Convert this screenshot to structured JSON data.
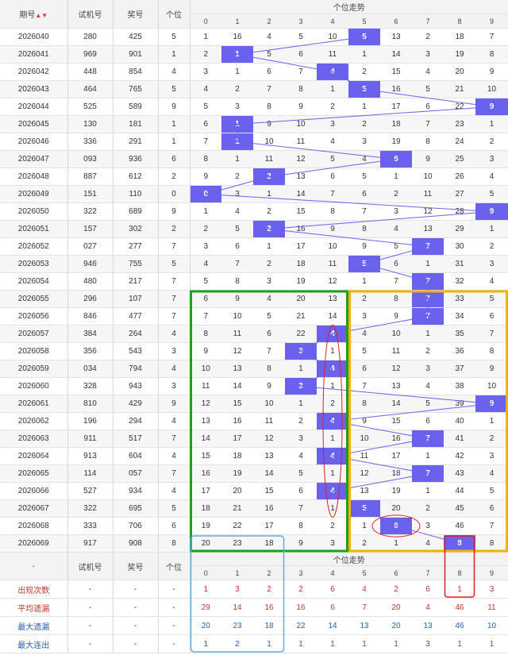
{
  "header": {
    "issue": "期号",
    "sort_arrow": "▲▼",
    "trial": "试机号",
    "prize": "奖号",
    "units": "个位",
    "trend": "个位走势",
    "digits": [
      "0",
      "1",
      "2",
      "3",
      "4",
      "5",
      "6",
      "7",
      "8",
      "9"
    ]
  },
  "rows": [
    {
      "issue": "2026040",
      "trial": "280",
      "prize": "425",
      "unit": "5",
      "cells": [
        "1",
        "16",
        "4",
        "5",
        "10",
        "5",
        "13",
        "2",
        "18",
        "7"
      ]
    },
    {
      "issue": "2026041",
      "trial": "969",
      "prize": "901",
      "unit": "1",
      "cells": [
        "2",
        "1",
        "5",
        "6",
        "11",
        "1",
        "14",
        "3",
        "19",
        "8"
      ]
    },
    {
      "issue": "2026042",
      "trial": "448",
      "prize": "854",
      "unit": "4",
      "cells": [
        "3",
        "1",
        "6",
        "7",
        "4",
        "2",
        "15",
        "4",
        "20",
        "9"
      ]
    },
    {
      "issue": "2026043",
      "trial": "464",
      "prize": "765",
      "unit": "5",
      "cells": [
        "4",
        "2",
        "7",
        "8",
        "1",
        "5",
        "16",
        "5",
        "21",
        "10"
      ]
    },
    {
      "issue": "2026044",
      "trial": "525",
      "prize": "589",
      "unit": "9",
      "cells": [
        "5",
        "3",
        "8",
        "9",
        "2",
        "1",
        "17",
        "6",
        "22",
        "9"
      ]
    },
    {
      "issue": "2026045",
      "trial": "130",
      "prize": "181",
      "unit": "1",
      "cells": [
        "6",
        "1",
        "9",
        "10",
        "3",
        "2",
        "18",
        "7",
        "23",
        "1"
      ]
    },
    {
      "issue": "2026046",
      "trial": "336",
      "prize": "291",
      "unit": "1",
      "cells": [
        "7",
        "1",
        "10",
        "11",
        "4",
        "3",
        "19",
        "8",
        "24",
        "2"
      ]
    },
    {
      "issue": "2026047",
      "trial": "093",
      "prize": "936",
      "unit": "6",
      "cells": [
        "8",
        "1",
        "11",
        "12",
        "5",
        "4",
        "6",
        "9",
        "25",
        "3"
      ]
    },
    {
      "issue": "2026048",
      "trial": "887",
      "prize": "612",
      "unit": "2",
      "cells": [
        "9",
        "2",
        "2",
        "13",
        "6",
        "5",
        "1",
        "10",
        "26",
        "4"
      ]
    },
    {
      "issue": "2026049",
      "trial": "151",
      "prize": "110",
      "unit": "0",
      "cells": [
        "0",
        "3",
        "1",
        "14",
        "7",
        "6",
        "2",
        "11",
        "27",
        "5"
      ]
    },
    {
      "issue": "2026050",
      "trial": "322",
      "prize": "689",
      "unit": "9",
      "cells": [
        "1",
        "4",
        "2",
        "15",
        "8",
        "7",
        "3",
        "12",
        "28",
        "9"
      ]
    },
    {
      "issue": "2026051",
      "trial": "157",
      "prize": "302",
      "unit": "2",
      "cells": [
        "2",
        "5",
        "2",
        "16",
        "9",
        "8",
        "4",
        "13",
        "29",
        "1"
      ]
    },
    {
      "issue": "2026052",
      "trial": "027",
      "prize": "277",
      "unit": "7",
      "cells": [
        "3",
        "6",
        "1",
        "17",
        "10",
        "9",
        "5",
        "7",
        "30",
        "2"
      ]
    },
    {
      "issue": "2026053",
      "trial": "946",
      "prize": "755",
      "unit": "5",
      "cells": [
        "4",
        "7",
        "2",
        "18",
        "11",
        "5",
        "6",
        "1",
        "31",
        "3"
      ]
    },
    {
      "issue": "2026054",
      "trial": "480",
      "prize": "217",
      "unit": "7",
      "cells": [
        "5",
        "8",
        "3",
        "19",
        "12",
        "1",
        "7",
        "7",
        "32",
        "4"
      ]
    },
    {
      "issue": "2026055",
      "trial": "296",
      "prize": "107",
      "unit": "7",
      "cells": [
        "6",
        "9",
        "4",
        "20",
        "13",
        "2",
        "8",
        "7",
        "33",
        "5"
      ]
    },
    {
      "issue": "2026056",
      "trial": "846",
      "prize": "477",
      "unit": "7",
      "cells": [
        "7",
        "10",
        "5",
        "21",
        "14",
        "3",
        "9",
        "7",
        "34",
        "6"
      ]
    },
    {
      "issue": "2026057",
      "trial": "384",
      "prize": "264",
      "unit": "4",
      "cells": [
        "8",
        "11",
        "6",
        "22",
        "4",
        "4",
        "10",
        "1",
        "35",
        "7"
      ]
    },
    {
      "issue": "2026058",
      "trial": "356",
      "prize": "543",
      "unit": "3",
      "cells": [
        "9",
        "12",
        "7",
        "3",
        "1",
        "5",
        "11",
        "2",
        "36",
        "8"
      ]
    },
    {
      "issue": "2026059",
      "trial": "034",
      "prize": "794",
      "unit": "4",
      "cells": [
        "10",
        "13",
        "8",
        "1",
        "4",
        "6",
        "12",
        "3",
        "37",
        "9"
      ]
    },
    {
      "issue": "2026060",
      "trial": "328",
      "prize": "943",
      "unit": "3",
      "cells": [
        "11",
        "14",
        "9",
        "3",
        "1",
        "7",
        "13",
        "4",
        "38",
        "10"
      ]
    },
    {
      "issue": "2026061",
      "trial": "810",
      "prize": "429",
      "unit": "9",
      "cells": [
        "12",
        "15",
        "10",
        "1",
        "2",
        "8",
        "14",
        "5",
        "39",
        "9"
      ]
    },
    {
      "issue": "2026062",
      "trial": "196",
      "prize": "294",
      "unit": "4",
      "cells": [
        "13",
        "16",
        "11",
        "2",
        "4",
        "9",
        "15",
        "6",
        "40",
        "1"
      ]
    },
    {
      "issue": "2026063",
      "trial": "911",
      "prize": "517",
      "unit": "7",
      "cells": [
        "14",
        "17",
        "12",
        "3",
        "1",
        "10",
        "16",
        "7",
        "41",
        "2"
      ]
    },
    {
      "issue": "2026064",
      "trial": "913",
      "prize": "604",
      "unit": "4",
      "cells": [
        "15",
        "18",
        "13",
        "4",
        "4",
        "11",
        "17",
        "1",
        "42",
        "3"
      ]
    },
    {
      "issue": "2026065",
      "trial": "114",
      "prize": "057",
      "unit": "7",
      "cells": [
        "16",
        "19",
        "14",
        "5",
        "1",
        "12",
        "18",
        "7",
        "43",
        "4"
      ]
    },
    {
      "issue": "2026066",
      "trial": "527",
      "prize": "934",
      "unit": "4",
      "cells": [
        "17",
        "20",
        "15",
        "6",
        "4",
        "13",
        "19",
        "1",
        "44",
        "5"
      ]
    },
    {
      "issue": "2026067",
      "trial": "322",
      "prize": "695",
      "unit": "5",
      "cells": [
        "18",
        "21",
        "16",
        "7",
        "1",
        "5",
        "20",
        "2",
        "45",
        "6"
      ]
    },
    {
      "issue": "2026068",
      "trial": "333",
      "prize": "706",
      "unit": "6",
      "cells": [
        "19",
        "22",
        "17",
        "8",
        "2",
        "1",
        "6",
        "3",
        "46",
        "7"
      ]
    },
    {
      "issue": "2026069",
      "trial": "917",
      "prize": "908",
      "unit": "8",
      "cells": [
        "20",
        "23",
        "18",
        "9",
        "3",
        "2",
        "1",
        "4",
        "8",
        "8"
      ]
    }
  ],
  "footer": {
    "dash": "-",
    "trial": "试机号",
    "prize": "奖号",
    "units": "个位",
    "trend": "个位走势",
    "stats": [
      {
        "label": "出现次数",
        "style": "red",
        "values": [
          "1",
          "3",
          "2",
          "2",
          "6",
          "4",
          "2",
          "6",
          "1",
          "3"
        ]
      },
      {
        "label": "平均遗漏",
        "style": "red",
        "values": [
          "29",
          "14",
          "16",
          "16",
          "6",
          "7",
          "20",
          "4",
          "46",
          "11"
        ]
      },
      {
        "label": "最大遗漏",
        "style": "blue",
        "values": [
          "20",
          "23",
          "18",
          "22",
          "14",
          "13",
          "20",
          "13",
          "46",
          "10"
        ]
      },
      {
        "label": "最大连出",
        "style": "blue",
        "values": [
          "1",
          "2",
          "1",
          "1",
          "1",
          "1",
          "1",
          "3",
          "1",
          "1"
        ]
      }
    ]
  },
  "colors": {
    "hit": "#6a62ee",
    "line": "#6a62ee",
    "green": "#1aa31a",
    "orange": "#f5b000",
    "red": "#e02020",
    "blue": "#5ab0e8"
  },
  "chart_data": {
    "type": "table",
    "title": "个位走势",
    "x": [
      "2026040",
      "2026041",
      "2026042",
      "2026043",
      "2026044",
      "2026045",
      "2026046",
      "2026047",
      "2026048",
      "2026049",
      "2026050",
      "2026051",
      "2026052",
      "2026053",
      "2026054",
      "2026055",
      "2026056",
      "2026057",
      "2026058",
      "2026059",
      "2026060",
      "2026061",
      "2026062",
      "2026063",
      "2026064",
      "2026065",
      "2026066",
      "2026067",
      "2026068",
      "2026069"
    ],
    "series": [
      {
        "values": [
          5,
          1,
          4,
          5,
          9,
          1,
          1,
          6,
          2,
          0,
          9,
          2,
          7,
          5,
          7,
          7,
          7,
          4,
          3,
          4,
          3,
          9,
          4,
          7,
          4,
          7,
          4,
          5,
          6,
          8
        ]
      }
    ]
  }
}
